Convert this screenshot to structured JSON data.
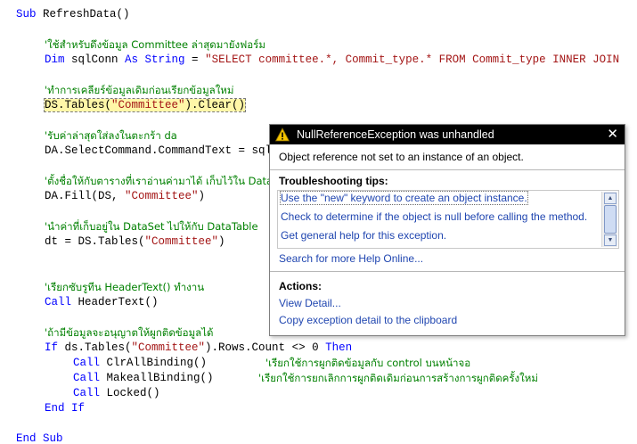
{
  "code": {
    "l1_kw": "Sub",
    "l1_rest": " RefreshData()",
    "c1": "'ใช้สำหรับดึงข้อมูล Committee ล่าสุดมายังฟอร์ม",
    "l2_kw1": "Dim",
    "l2_mid": " sqlConn ",
    "l2_kw2": "As String",
    "l2_eq": " = ",
    "l2_str": "\"SELECT committee.*, Commit_type.* FROM Commit_type INNER JOIN",
    "c2": "'ทำการเคลียร์ข้อมูลเดิมก่อนเรียกข้อมูลใหม่",
    "l3_a": "DS.Tables(",
    "l3_str": "\"Committee\"",
    "l3_b": ").Clear()",
    "c3": "'รับค่าล่าสุดใส่ลงในตะกร้า da",
    "l4": "DA.SelectCommand.CommandText = sqlConn",
    "c4": "'ตั้งชื่อให้กับตารางที่เราอ่านค่ามาได้ เก็บไว้ใน DataSet",
    "l5_a": "DA.Fill(DS, ",
    "l5_str": "\"Committee\"",
    "l5_b": ")",
    "c5": "'นำค่าที่เก็บอยู่ใน DataSet ไปให้กับ DataTable",
    "l6_a": "dt = DS.Tables(",
    "l6_str": "\"Committee\"",
    "l6_b": ")",
    "c6": "'เรียกซับรูทีน HeaderText() ทำงาน",
    "l7_kw": "Call",
    "l7_rest": " HeaderText()",
    "c7": "'ถ้ามีข้อมูลจะอนุญาตให้ผูกติดข้อมูลได้",
    "l8_kw": "If",
    "l8_a": " ds.Tables(",
    "l8_str": "\"Committee\"",
    "l8_b": ").Rows.Count <> 0 ",
    "l8_kw2": "Then",
    "l9_kw": "Call",
    "l9_rest": " ClrAllBinding()",
    "c9": "'เรียกใช้การผูกติดข้อมูลกับ control บนหน้าจอ",
    "l10_kw": "Call",
    "l10_rest": " MakeallBinding()",
    "c10": "'เรียกใช้การยกเลิกการผูกติดเดิมก่อนการสร้างการผูกติดครั้งใหม่",
    "l11_kw": "Call",
    "l11_rest": " Locked()",
    "l12": "End If",
    "l13": "End Sub"
  },
  "exception": {
    "title": "NullReferenceException was unhandled",
    "close_glyph": "✕",
    "message": "Object reference not set to an instance of an object.",
    "tips_heading": "Troubleshooting tips:",
    "tips": [
      "Use the \"new\" keyword to create an object instance.",
      "Check to determine if the object is null before calling the method.",
      "Get general help for this exception."
    ],
    "search_link": "Search for more Help Online...",
    "actions_heading": "Actions:",
    "actions": [
      "View Detail...",
      "Copy exception detail to the clipboard"
    ],
    "icon": "warning-icon",
    "colors": {
      "header_bg": "#000000",
      "link": "#2046b0",
      "keyword": "#0000ff",
      "string": "#a31515",
      "comment": "#008000"
    }
  }
}
